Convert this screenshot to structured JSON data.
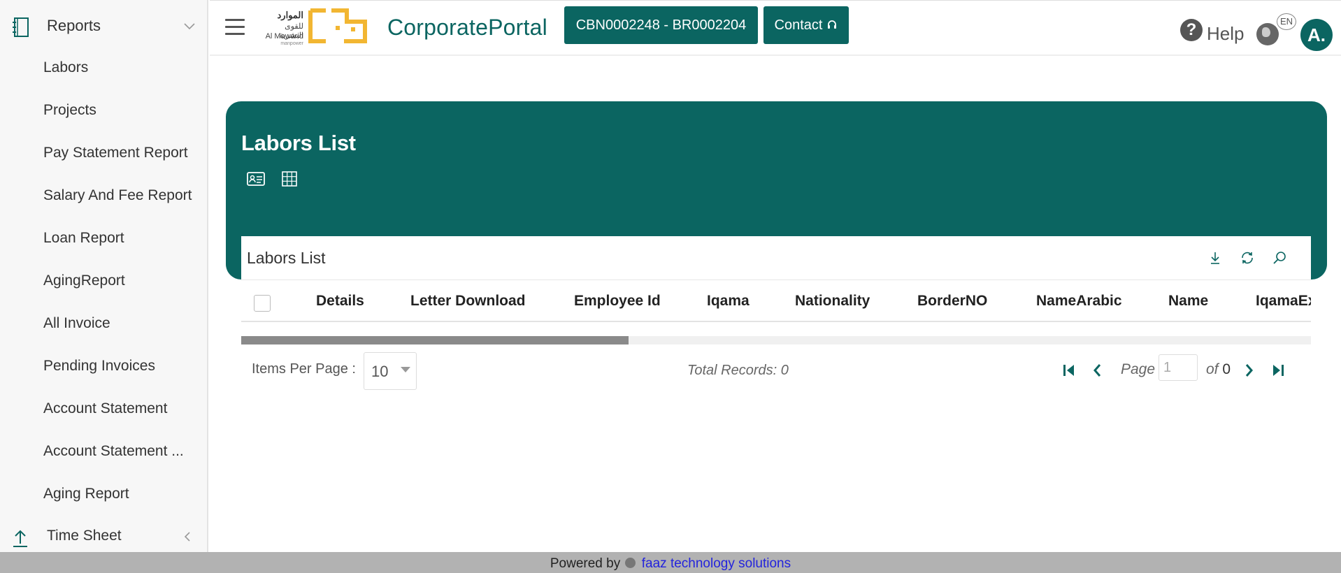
{
  "sidebar": {
    "header_label": "Reports",
    "items": [
      {
        "label": "Labors"
      },
      {
        "label": "Projects"
      },
      {
        "label": "Pay Statement Report"
      },
      {
        "label": "Salary And Fee Report"
      },
      {
        "label": "Loan Report"
      },
      {
        "label": "AgingReport"
      },
      {
        "label": "All Invoice"
      },
      {
        "label": "Pending Invoices"
      },
      {
        "label": "Account Statement"
      },
      {
        "label": "Account Statement ..."
      },
      {
        "label": "Aging Report"
      }
    ],
    "footer_label": "Time Sheet"
  },
  "topbar": {
    "logo_ar": "الموارد",
    "logo_ar2": "للقوى البشرية",
    "logo_en": "Al Mawarid",
    "logo_en2": "manpower",
    "portal_title": "CorporatePortal",
    "code_button": "CBN0002248 - BR0002204",
    "contact_button": "Contact",
    "help_label": "Help",
    "lang": "EN",
    "avatar_initial": "A."
  },
  "card": {
    "title": "Labors List",
    "panel_title": "Labors List"
  },
  "grid": {
    "columns": [
      "Details",
      "Letter Download",
      "Employee Id",
      "Iqama",
      "Nationality",
      "BorderNO",
      "NameArabic",
      "Name",
      "IqamaEx"
    ]
  },
  "pager": {
    "items_per_page_label": "Items Per Page :",
    "items_per_page_value": "10",
    "total_records": "Total Records: 0",
    "page_label": "Page",
    "page_value": "1",
    "of_label": "of",
    "page_count": "0"
  },
  "footer": {
    "powered_by": "Powered by",
    "link_text": "faaz technology solutions"
  },
  "colors": {
    "primary": "#0b6561",
    "logo_yellow": "#f2b632",
    "footer_bg": "#b2b2b2",
    "link": "#2323dd"
  }
}
